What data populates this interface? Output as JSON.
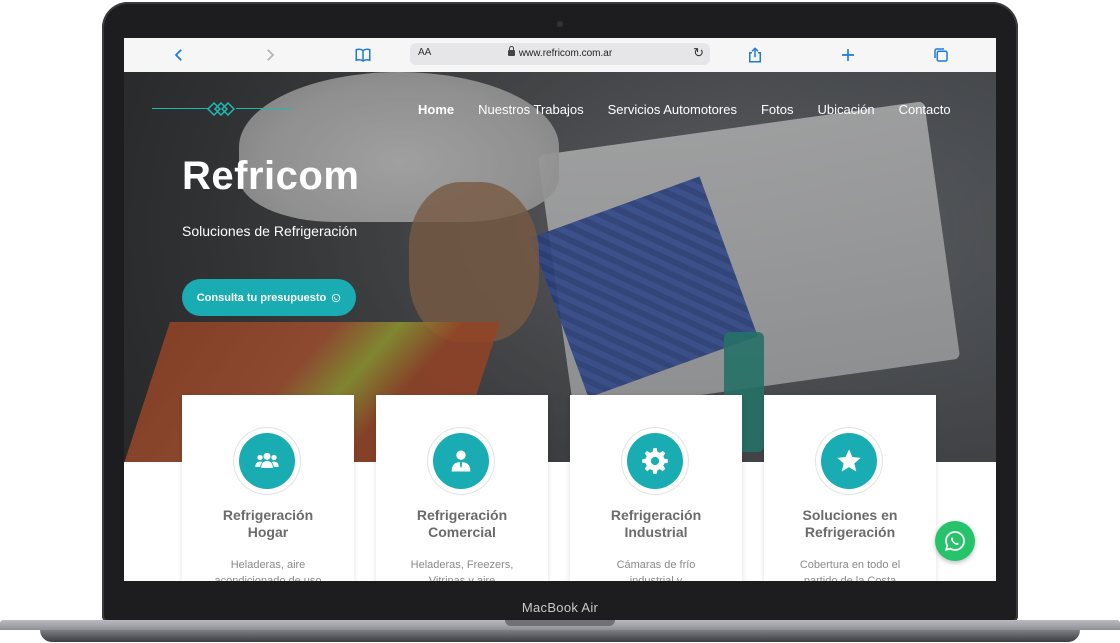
{
  "browser": {
    "url": "www.refricom.com.ar",
    "text_size_label": "AA"
  },
  "device": {
    "label": "MacBook Air"
  },
  "nav": {
    "items": [
      {
        "label": "Home"
      },
      {
        "label": "Nuestros Trabajos"
      },
      {
        "label": "Servicios Automotores"
      },
      {
        "label": "Fotos"
      },
      {
        "label": "Ubicación"
      },
      {
        "label": "Contacto"
      }
    ]
  },
  "hero": {
    "brand": "Refricom",
    "tagline": "Soluciones de Refrigeración",
    "cta_label": "Consulta tu presupuesto"
  },
  "cards": [
    {
      "icon": "users-icon",
      "title_line1": "Refrigeración",
      "title_line2": "Hogar",
      "desc_line1": "Heladeras, aire",
      "desc_line2": "acondicionado de uso"
    },
    {
      "icon": "business-person-icon",
      "title_line1": "Refrigeración",
      "title_line2": "Comercial",
      "desc_line1": "Heladeras, Freezers,",
      "desc_line2": "Vitrinas y aire"
    },
    {
      "icon": "gear-icon",
      "title_line1": "Refrigeración",
      "title_line2": "Industrial",
      "desc_line1": "Cámaras de frío",
      "desc_line2": "industrial y"
    },
    {
      "icon": "star-icon",
      "title_line1": "Soluciones en",
      "title_line2": "Refrigeración",
      "desc_line1": "Cobertura en todo el",
      "desc_line2": "partido de la Costa"
    }
  ],
  "colors": {
    "accent": "#1aacb3",
    "whatsapp": "#25c36a"
  }
}
